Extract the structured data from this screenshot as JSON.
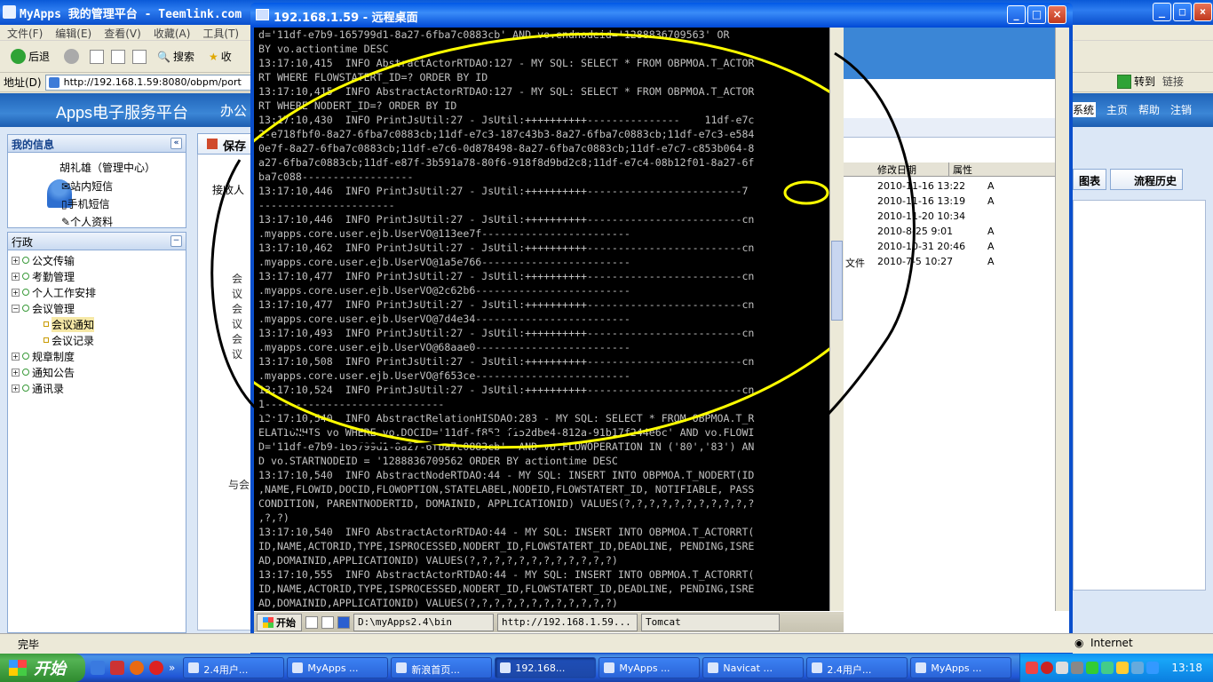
{
  "ie": {
    "title": "MyApps 我的管理平台 - Teemlink.com",
    "menu": [
      "文件(F)",
      "编辑(E)",
      "查看(V)",
      "收藏(A)",
      "工具(T)"
    ],
    "toolbar": {
      "back": "后退",
      "search": "搜索",
      "favorites": "收"
    },
    "address_label": "地址(D)",
    "address": "http://192.168.1.59:8080/obpm/port",
    "go": "转到",
    "links": "链接"
  },
  "app": {
    "logo": "Apps电子服务平台",
    "nav": "办公",
    "save": "保存",
    "right_nav": [
      "系统",
      "主页",
      "帮助",
      "注销"
    ],
    "right_buttons": [
      "图表",
      "流程历史"
    ],
    "myinfo": {
      "title": "我的信息",
      "user": "胡礼雄（管理中心）",
      "links": [
        "站内短信",
        "手机短信",
        "个人资料"
      ]
    },
    "admin": {
      "title": "行政",
      "items": [
        "公文传输",
        "考勤管理",
        "个人工作安排",
        "会议管理"
      ],
      "sub": [
        "会议通知",
        "会议记录"
      ],
      "more": [
        "规章制度",
        "通知公告",
        "通讯录"
      ]
    },
    "labels": [
      "会议",
      "会议",
      "会议",
      "与会"
    ],
    "left_label": "接收人"
  },
  "rd": {
    "title": "192.168.1.59 - 远程桌面",
    "console": [
      "d='11df-e7b9-165799d1-8a27-6fba7c0883cb' AND vo.endnodeid='1288836709563' OR",
      "BY vo.actiontime DESC",
      "13:17:10,415  INFO AbstractActorRTDAO:127 - MY SQL: SELECT * FROM OBPMOA.T_ACTOR",
      "RT WHERE FLOWSTATERT_ID=? ORDER BY ID",
      "13:17:10,415  INFO AbstractActorRTDAO:127 - MY SQL: SELECT * FROM OBPMOA.T_ACTOR",
      "RT WHERE NODERT_ID=? ORDER BY ID",
      "13:17:10,430  INFO PrintJsUtil:27 - JsUtil:++++++++++---------------    11df-e7c",
      "2-e718fbf0-8a27-6fba7c0883cb;11df-e7c3-187c43b3-8a27-6fba7c0883cb;11df-e7c3-e584",
      "0e7f-8a27-6fba7c0883cb;11df-e7c6-0d878498-8a27-6fba7c0883cb;11df-e7c7-c853b064-8",
      "a27-6fba7c0883cb;11df-e87f-3b591a78-80f6-918f8d9bd2c8;11df-e7c4-08b12f01-8a27-6f",
      "ba7c088------------------",
      "13:17:10,446  INFO PrintJsUtil:27 - JsUtil:++++++++++-------------------------7",
      "----------------------",
      "13:17:10,446  INFO PrintJsUtil:27 - JsUtil:++++++++++-------------------------cn",
      ".myapps.core.user.ejb.UserVO@113ee7f------------------------",
      "13:17:10,462  INFO PrintJsUtil:27 - JsUtil:++++++++++-------------------------cn",
      ".myapps.core.user.ejb.UserVO@1a5e766------------------------",
      "13:17:10,477  INFO PrintJsUtil:27 - JsUtil:++++++++++-------------------------cn",
      ".myapps.core.user.ejb.UserVO@2c62b6-------------------------",
      "13:17:10,477  INFO PrintJsUtil:27 - JsUtil:++++++++++-------------------------cn",
      ".myapps.core.user.ejb.UserVO@7d4e34-------------------------",
      "13:17:10,493  INFO PrintJsUtil:27 - JsUtil:++++++++++-------------------------cn",
      ".myapps.core.user.ejb.UserVO@68aae0-------------------------",
      "13:17:10,508  INFO PrintJsUtil:27 - JsUtil:++++++++++-------------------------cn",
      ".myapps.core.user.ejb.UserVO@f653ce-------------------------",
      "13:17:10,524  INFO PrintJsUtil:27 - JsUtil:++++++++++-------------------------cn",
      "1-----------------------------",
      "13:17:10,540  INFO AbstractRelationHISDAO:283 - MY SQL: SELECT * FROM OBPMOA.T_R",
      "ELATIONHIS vo WHERE vo.DOCID='11df-f852-f152dbe4-812a-91b17f244e6c' AND vo.FLOWI",
      "D='11df-e7b9-165799d1-8a27-6fba7c0883cb'  AND vo.FLOWOPERATION IN ('80','83') AN",
      "D vo.STARTNODEID = '1288836709562 ORDER BY actiontime DESC",
      "13:17:10,540  INFO AbstractNodeRTDAO:44 - MY SQL: INSERT INTO OBPMOA.T_NODERT(ID",
      ",NAME,FLOWID,DOCID,FLOWOPTION,STATELABEL,NODEID,FLOWSTATERT_ID, NOTIFIABLE, PASS",
      "CONDITION, PARENTNODERTID, DOMAINID, APPLICATIONID) VALUES(?,?,?,?,?,?,?,?,?,?,?",
      ",?,?)",
      "13:17:10,540  INFO AbstractActorRTDAO:44 - MY SQL: INSERT INTO OBPMOA.T_ACTORRT(",
      "ID,NAME,ACTORID,TYPE,ISPROCESSED,NODERT_ID,FLOWSTATERT_ID,DEADLINE, PENDING,ISRE",
      "AD,DOMAINID,APPLICATIONID) VALUES(?,?,?,?,?,?,?,?,?,?,?,?)",
      "13:17:10,555  INFO AbstractActorRTDAO:44 - MY SQL: INSERT INTO OBPMOA.T_ACTORRT(",
      "ID,NAME,ACTORID,TYPE,ISPROCESSED,NODERT_ID,FLOWSTATERT_ID,DEADLINE, PENDING,ISRE",
      "AD,DOMAINID,APPLICATIONID) VALUES(?,?,?,?,?,?,?,?,?,?,?,?)"
    ],
    "table": {
      "headers": [
        "修改日期",
        "属性"
      ],
      "rows": [
        {
          "date": "2010-11-16 13:22",
          "attr": "A"
        },
        {
          "date": "2010-11-16 13:19",
          "attr": "A"
        },
        {
          "date": "2010-11-20 10:34",
          "attr": ""
        },
        {
          "date": "2010-8-25 9:01",
          "attr": "A"
        },
        {
          "date": "2010-10-31 20:46",
          "attr": "A"
        },
        {
          "date": "2010-7-5 10:27",
          "attr": "A",
          "prefix": "文件"
        }
      ]
    },
    "taskbar": {
      "start": "开始",
      "tasks": [
        "D:\\myApps2.4\\bin",
        "http://192.168.1.59...",
        "Tomcat"
      ]
    }
  },
  "status": {
    "done": "完毕",
    "zone": "Internet"
  },
  "taskbar": {
    "start": "开始",
    "tasks": [
      "2.4用户...",
      "MyApps ...",
      "新浪首页...",
      "192.168...",
      "MyApps ...",
      "Navicat ...",
      "2.4用户...",
      "MyApps ..."
    ],
    "clock": "13:18"
  }
}
